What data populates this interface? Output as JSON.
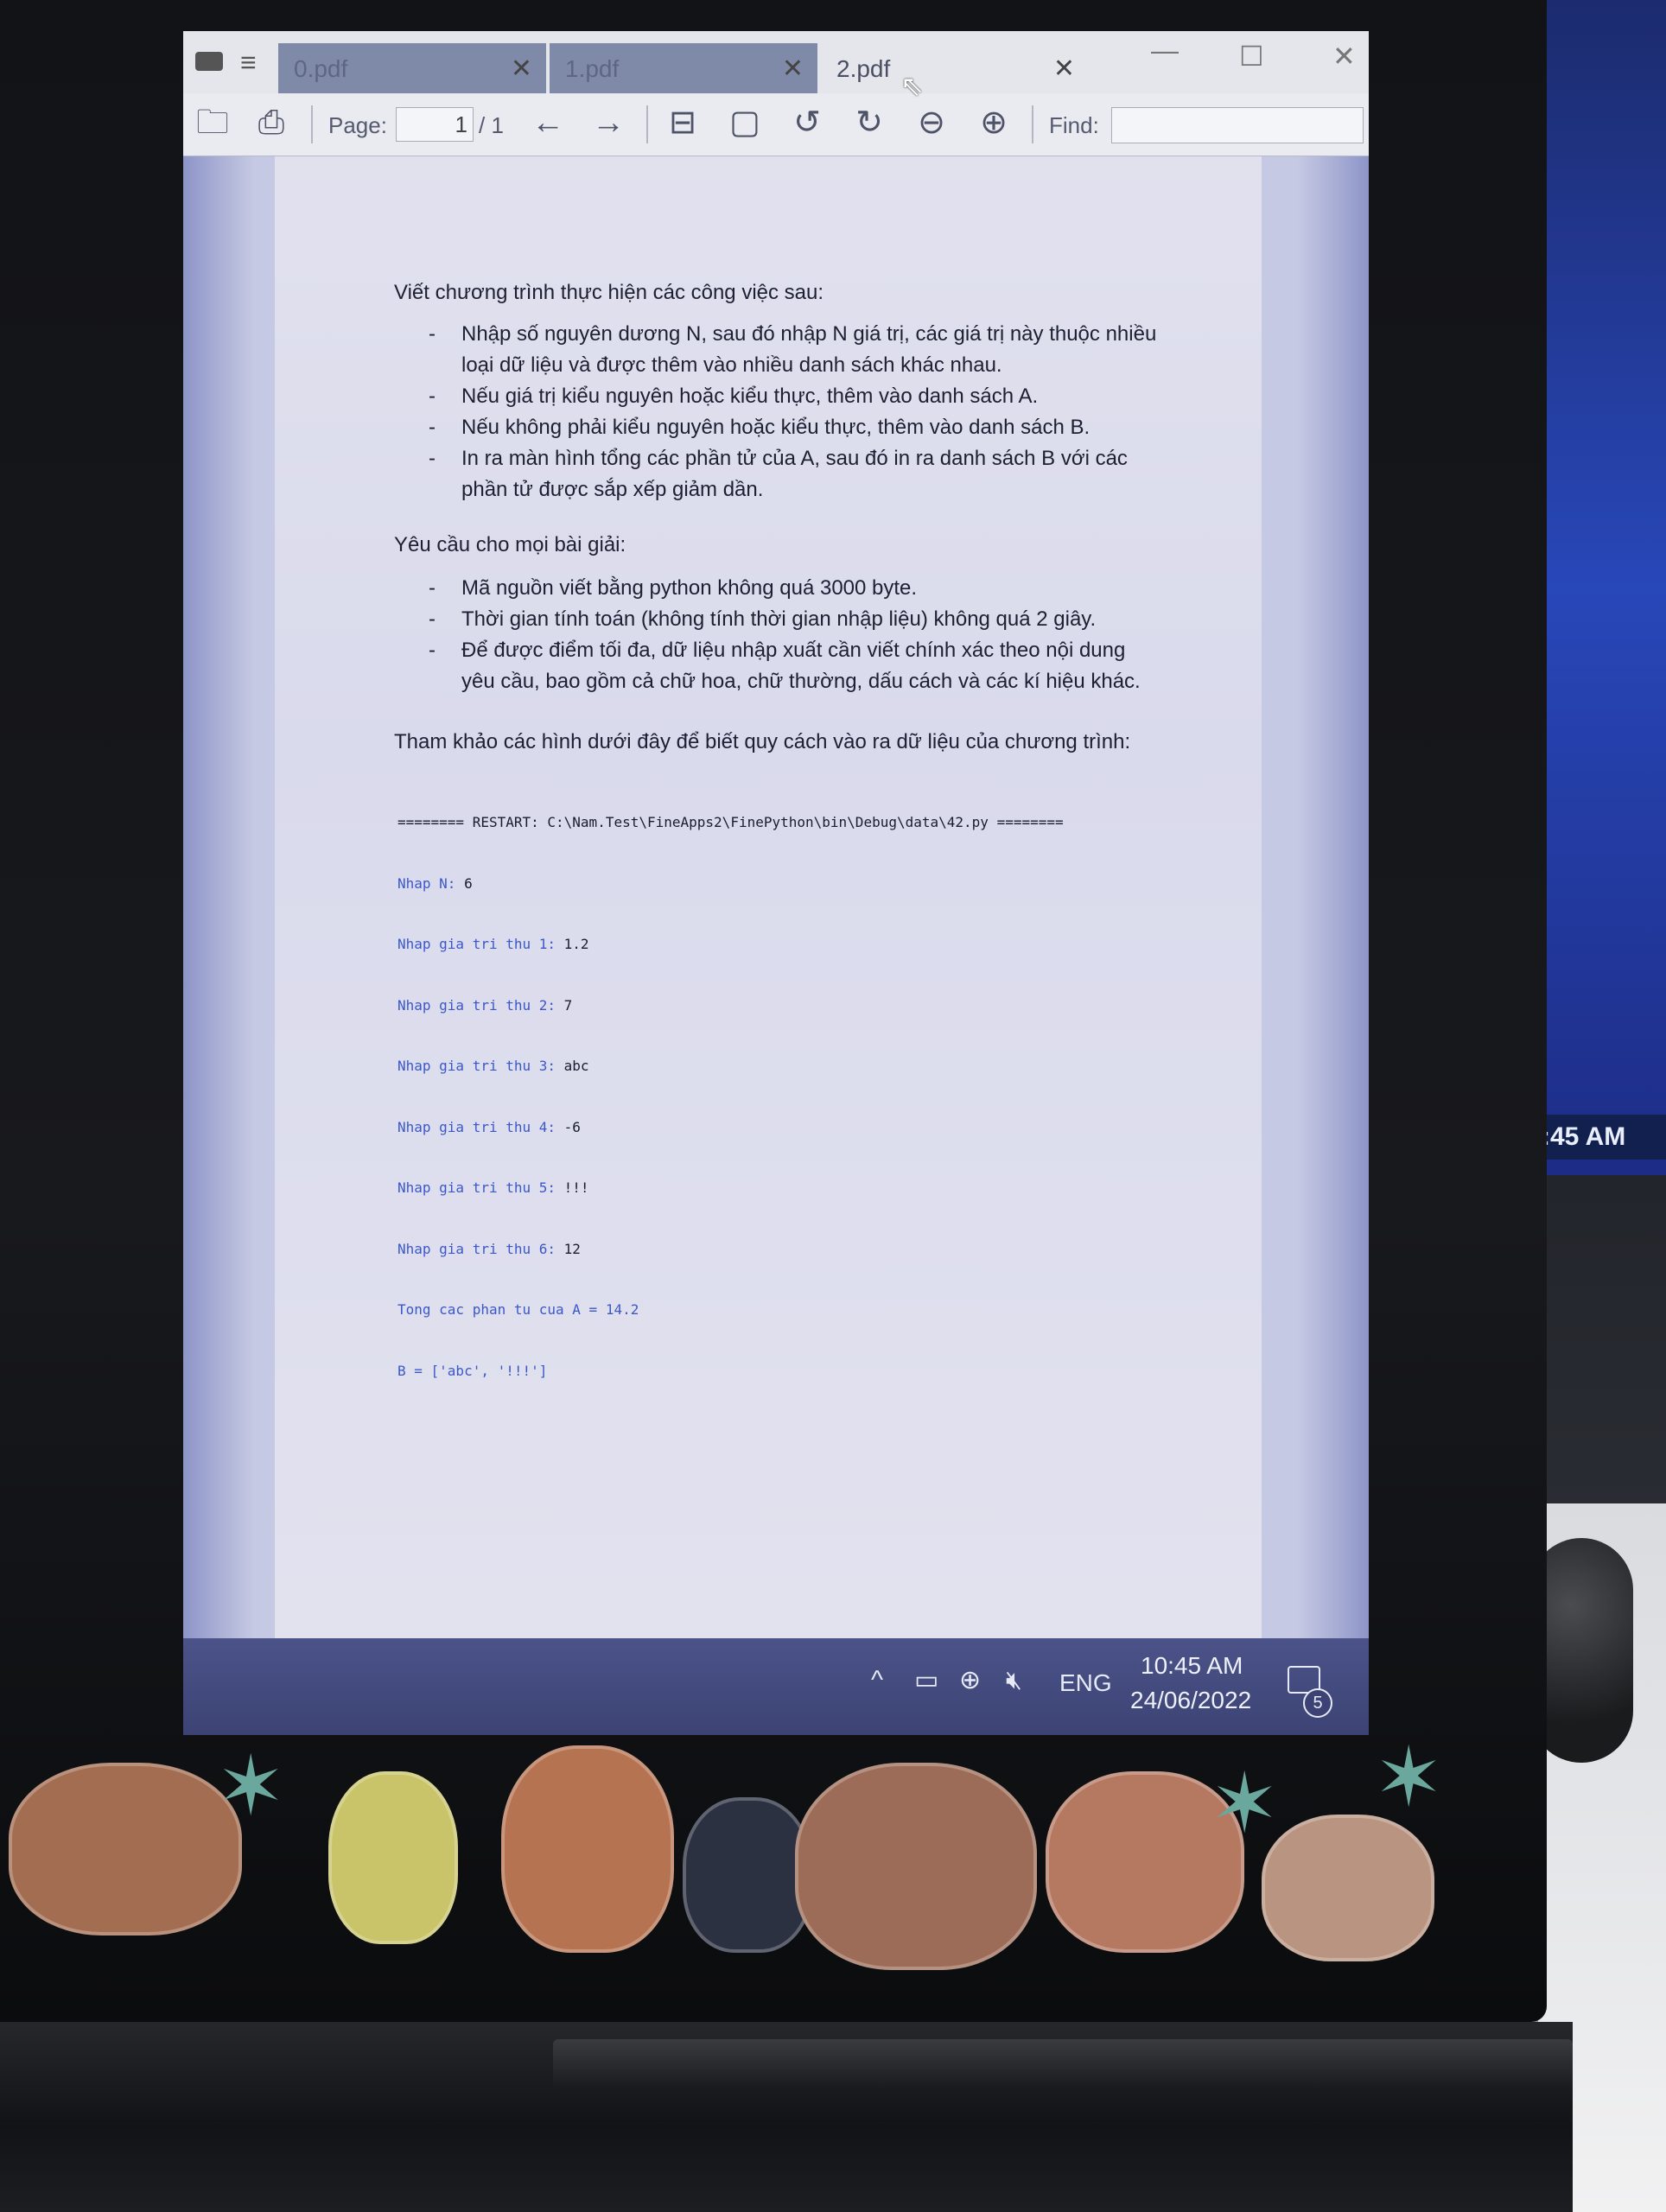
{
  "window": {
    "tabs": [
      {
        "label": "0.pdf",
        "close": "✕"
      },
      {
        "label": "1.pdf",
        "close": "✕"
      },
      {
        "label": "2.pdf",
        "close": "✕"
      }
    ],
    "controls": {
      "minimize": "—",
      "maximize": "☐",
      "close": "✕"
    }
  },
  "toolbar": {
    "page_label": "Page:",
    "page_value": "1",
    "page_total": "/ 1",
    "find_label": "Find:",
    "find_value": ""
  },
  "document": {
    "intro": "Viết chương trình thực hiện các công việc sau:",
    "tasks": [
      "Nhập số nguyên dương N, sau đó nhập N giá trị, các giá trị này thuộc nhiều",
      "loại dữ liệu và được thêm vào nhiều danh sách khác nhau.",
      "Nếu giá trị kiểu nguyên hoặc kiểu thực, thêm vào danh sách A.",
      "Nếu không phải kiểu nguyên hoặc kiểu thực, thêm vào danh sách B.",
      "In ra màn hình tổng các phần tử của A, sau đó in ra danh sách B với các",
      "phần tử được sắp xếp giảm dần."
    ],
    "requirements_heading": "Yêu cầu cho mọi bài giải:",
    "requirements": [
      "Mã nguồn viết bằng python không quá 3000 byte.",
      "Thời gian tính toán (không tính thời gian nhập liệu) không quá 2 giây.",
      "Để được điểm tối đa, dữ liệu nhập xuất cần viết chính xác theo nội dung",
      "yêu cầu, bao gồm cả chữ hoa, chữ thường, dấu cách và các kí hiệu khác."
    ],
    "reference_note": "Tham khảo các hình dưới đây để biết quy cách vào ra dữ liệu của chương trình:",
    "console_lines": [
      {
        "prompt": "======== RESTART: C:\\Nam.Test\\FineApps2\\FinePython\\bin\\Debug\\data\\42.py ========",
        "value": ""
      },
      {
        "prompt": "Nhap N: ",
        "value": "6"
      },
      {
        "prompt": "Nhap gia tri thu 1: ",
        "value": "1.2"
      },
      {
        "prompt": "Nhap gia tri thu 2: ",
        "value": "7"
      },
      {
        "prompt": "Nhap gia tri thu 3: ",
        "value": "abc"
      },
      {
        "prompt": "Nhap gia tri thu 4: ",
        "value": "-6"
      },
      {
        "prompt": "Nhap gia tri thu 5: ",
        "value": "!!!"
      },
      {
        "prompt": "Nhap gia tri thu 6: ",
        "value": "12"
      },
      {
        "prompt": "Tong cac phan tu cua A = 14.2",
        "value": ""
      },
      {
        "prompt": "B = ['abc', '!!!']",
        "value": ""
      }
    ]
  },
  "taskbar": {
    "language": "ENG",
    "time": "10:45 AM",
    "date": "24/06/2022",
    "notification_count": "5"
  },
  "second_monitor": {
    "clock": ":45 AM"
  },
  "colors": {
    "console_prompt": "#3b58c8",
    "console_output": "#1a1c30",
    "taskbar": "#424a7e"
  }
}
